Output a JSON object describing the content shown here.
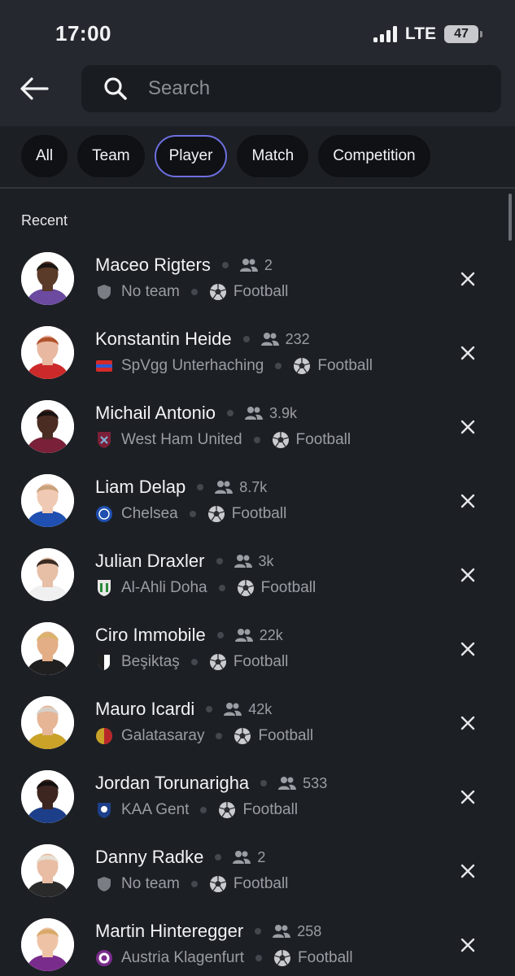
{
  "status": {
    "time": "17:00",
    "network": "LTE",
    "battery": "47"
  },
  "search": {
    "placeholder": "Search"
  },
  "filters": [
    {
      "label": "All",
      "active": false
    },
    {
      "label": "Team",
      "active": false
    },
    {
      "label": "Player",
      "active": true
    },
    {
      "label": "Match",
      "active": false
    },
    {
      "label": "Competition",
      "active": false
    }
  ],
  "recent": {
    "label": "Recent",
    "items": [
      {
        "name": "Maceo Rigters",
        "followers": "2",
        "team": "No team",
        "team_icon": "shield-icon",
        "sport": "Football",
        "skin": "#5a3a28",
        "hair": "#1c1512",
        "shirt": "#6b4aa0"
      },
      {
        "name": "Konstantin Heide",
        "followers": "232",
        "team": "SpVgg Unterhaching",
        "team_icon": "unterhaching-crest-icon",
        "sport": "Football",
        "skin": "#e8b8a0",
        "hair": "#b0522c",
        "shirt": "#cc2a2a"
      },
      {
        "name": "Michail Antonio",
        "followers": "3.9k",
        "team": "West Ham United",
        "team_icon": "west-ham-crest-icon",
        "sport": "Football",
        "skin": "#4a2c22",
        "hair": "#1a1210",
        "shirt": "#7a2038"
      },
      {
        "name": "Liam Delap",
        "followers": "8.7k",
        "team": "Chelsea",
        "team_icon": "chelsea-crest-icon",
        "sport": "Football",
        "skin": "#efc9b3",
        "hair": "#c9a17a",
        "shirt": "#1f4fb0"
      },
      {
        "name": "Julian Draxler",
        "followers": "3k",
        "team": "Al-Ahli Doha",
        "team_icon": "al-ahli-crest-icon",
        "sport": "Football",
        "skin": "#e6bfa6",
        "hair": "#3a2a22",
        "shirt": "#f0f0f0"
      },
      {
        "name": "Ciro Immobile",
        "followers": "22k",
        "team": "Beşiktaş",
        "team_icon": "besiktas-crest-icon",
        "sport": "Football",
        "skin": "#e3ae86",
        "hair": "#d9b36a",
        "shirt": "#202020"
      },
      {
        "name": "Mauro Icardi",
        "followers": "42k",
        "team": "Galatasaray",
        "team_icon": "galatasaray-crest-icon",
        "sport": "Football",
        "skin": "#e5b596",
        "hair": "#d6d0c8",
        "shirt": "#c9a227"
      },
      {
        "name": "Jordan Torunarigha",
        "followers": "533",
        "team": "KAA Gent",
        "team_icon": "gent-crest-icon",
        "sport": "Football",
        "skin": "#3d2620",
        "hair": "#151010",
        "shirt": "#1d3f8a"
      },
      {
        "name": "Danny Radke",
        "followers": "2",
        "team": "No team",
        "team_icon": "shield-icon",
        "sport": "Football",
        "skin": "#e9bda4",
        "hair": "#e6e0d4",
        "shirt": "#2a2a2a"
      },
      {
        "name": "Martin Hinteregger",
        "followers": "258",
        "team": "Austria Klagenfurt",
        "team_icon": "klagenfurt-crest-icon",
        "sport": "Football",
        "skin": "#eec3a5",
        "hair": "#d8a968",
        "shirt": "#7a2c8c"
      }
    ]
  },
  "colors": {
    "background": "#1c1f24",
    "header": "#25282e",
    "accent": "#6e6fe0",
    "muted_text": "#9a9da3"
  }
}
